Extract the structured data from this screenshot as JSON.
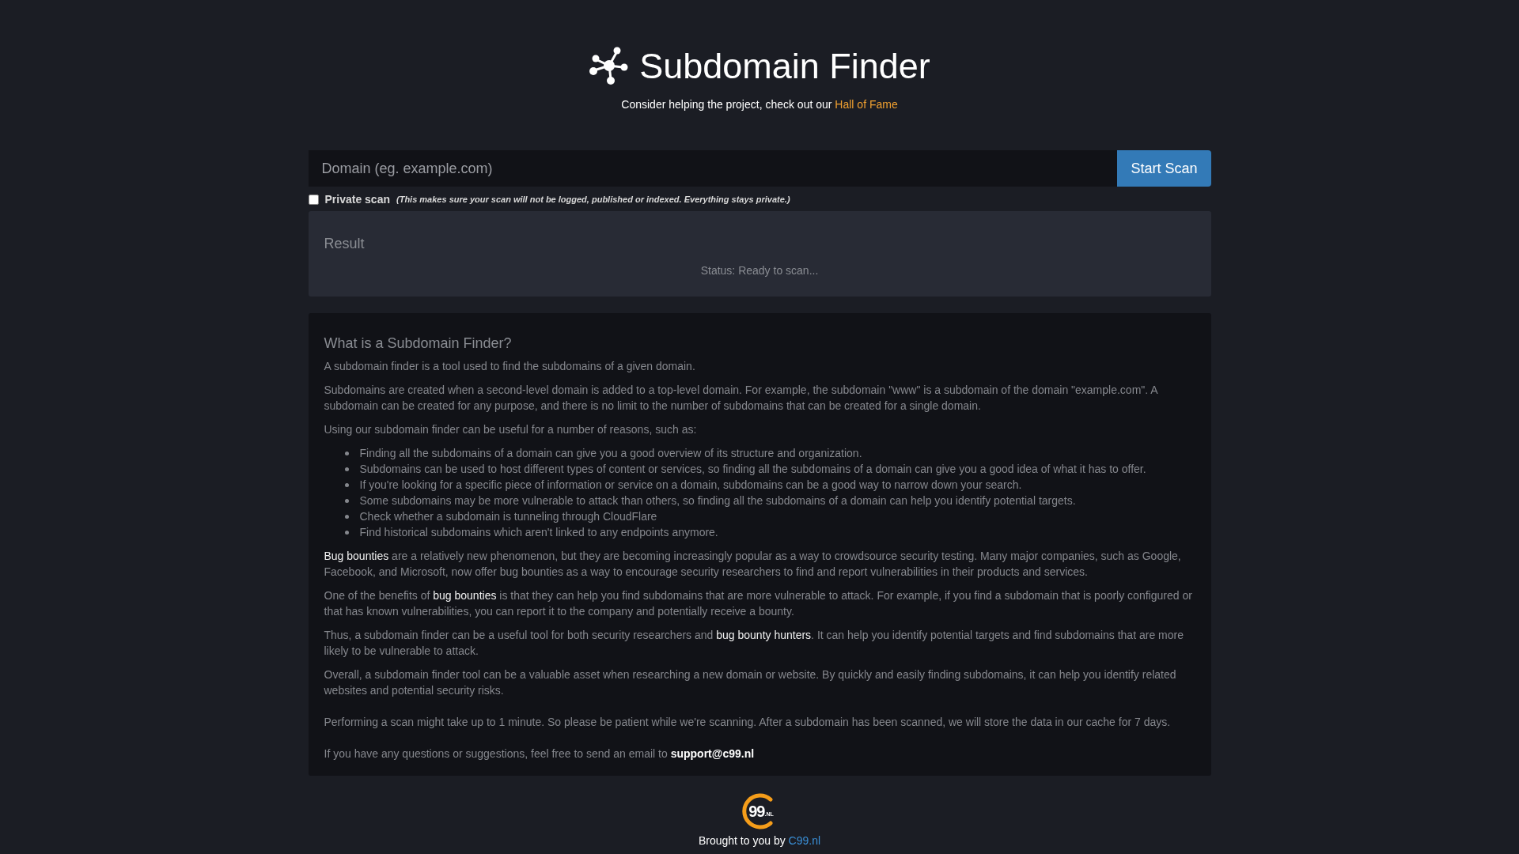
{
  "header": {
    "title": "Subdomain Finder",
    "subtitle": [
      {
        "kind": "text",
        "text": "Consider helping the project, check out our "
      },
      {
        "kind": "link",
        "text": "Hall of Fame"
      }
    ]
  },
  "search": {
    "placeholder": "Domain (eg. example.com)",
    "button": "Start Scan"
  },
  "private_scan": {
    "checked": false,
    "label": "Private scan",
    "note": "(This makes sure your scan will not be logged, published or indexed. Everything stays private.)"
  },
  "result": {
    "title": "Result",
    "status": "Status: Ready to scan..."
  },
  "info": {
    "title": "What is a Subdomain Finder?",
    "blocks": [
      {
        "kind": "paragraph",
        "parts": [
          {
            "kind": "text",
            "text": "A subdomain finder is a tool used to find the subdomains of a given domain."
          }
        ]
      },
      {
        "kind": "paragraph",
        "parts": [
          {
            "kind": "text",
            "text": "Subdomains are created when a second-level domain is added to a top-level domain. For example, the subdomain \"www\" is a subdomain of the domain \"example.com\". A subdomain can be created for any purpose, and there is no limit to the number of subdomains that can be created for a single domain."
          }
        ]
      },
      {
        "kind": "paragraph",
        "parts": [
          {
            "kind": "text",
            "text": "Using our subdomain finder can be useful for a number of reasons, such as:"
          }
        ]
      },
      {
        "kind": "list",
        "items": [
          "Finding all the subdomains of a domain can give you a good overview of its structure and organization.",
          "Subdomains can be used to host different types of content or services, so finding all the subdomains of a domain can give you a good idea of what it has to offer.",
          "If you're looking for a specific piece of information or service on a domain, subdomains can be a good way to narrow down your search.",
          "Some subdomains may be more vulnerable to attack than others, so finding all the subdomains of a domain can help you identify potential targets.",
          "Check whether a subdomain is tunneling through CloudFlare",
          "Find historical subdomains which aren't linked to any endpoints anymore."
        ]
      },
      {
        "kind": "paragraph",
        "parts": [
          {
            "kind": "link",
            "text": "Bug bounties"
          },
          {
            "kind": "text",
            "text": " are a relatively new phenomenon, but they are becoming increasingly popular as a way to crowdsource security testing. Many major companies, such as Google, Facebook, and Microsoft, now offer bug bounties as a way to encourage security researchers to find and report vulnerabilities in their products and services."
          }
        ]
      },
      {
        "kind": "paragraph",
        "parts": [
          {
            "kind": "text",
            "text": "One of the benefits of "
          },
          {
            "kind": "link",
            "text": "bug bounties"
          },
          {
            "kind": "text",
            "text": " is that they can help you find subdomains that are more vulnerable to attack. For example, if you find a subdomain that is poorly configured or that has known vulnerabilities, you can report it to the company and potentially receive a bounty."
          }
        ]
      },
      {
        "kind": "paragraph",
        "parts": [
          {
            "kind": "text",
            "text": "Thus, a subdomain finder can be a useful tool for both security researchers and "
          },
          {
            "kind": "link",
            "text": "bug bounty hunters"
          },
          {
            "kind": "text",
            "text": ". It can help you identify potential targets and find subdomains that are more likely to be vulnerable to attack."
          }
        ]
      },
      {
        "kind": "paragraph",
        "parts": [
          {
            "kind": "text",
            "text": "Overall, a subdomain finder tool can be a valuable asset when researching a new domain or website. By quickly and easily finding subdomains, it can help you identify related websites and potential security risks."
          }
        ]
      },
      {
        "kind": "spaced",
        "parts": [
          {
            "kind": "text",
            "text": "Performing a scan might take up to 1 minute. So please be patient while we're scanning. After a subdomain has been scanned, we will store the data in our cache for 7 days."
          }
        ]
      },
      {
        "kind": "spaced",
        "parts": [
          {
            "kind": "text",
            "text": "If you have any questions or suggestions, feel free to send an email to "
          },
          {
            "kind": "email",
            "text": "support@c99.nl"
          }
        ]
      }
    ]
  },
  "footer": {
    "logo_number": "99",
    "logo_suffix": ".NL",
    "credit": [
      {
        "kind": "text",
        "text": "Brought to you by "
      },
      {
        "kind": "credit_link",
        "text": "C99.nl"
      }
    ]
  }
}
